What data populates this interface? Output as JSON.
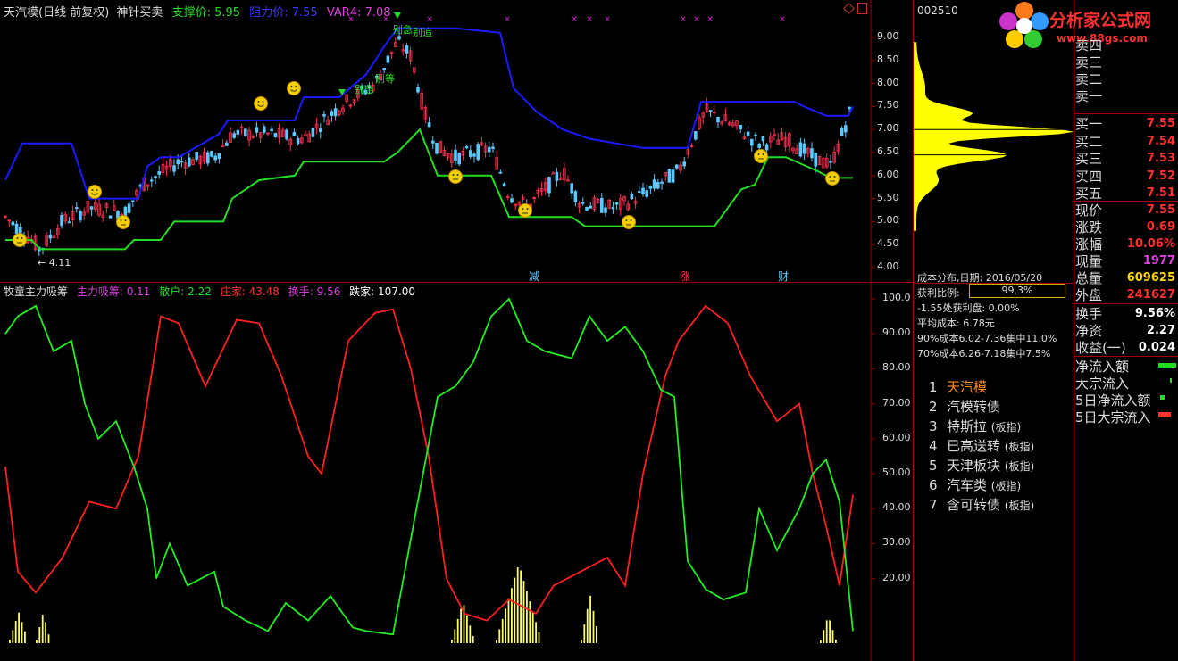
{
  "main_chart": {
    "stock_name": "天汽模(日线 前复权)",
    "indicator_name": "神针买卖",
    "support_label": "支撑价:",
    "support_value": "5.95",
    "resist_label": "阻力价:",
    "resist_value": "7.55",
    "var4_label": "VAR4:",
    "var4_value": "7.08",
    "low_marker": "← 4.11",
    "price_ticks": [
      "9.00",
      "8.50",
      "8.00",
      "7.50",
      "7.00",
      "6.50",
      "6.00",
      "5.50",
      "5.00",
      "4.50",
      "4.00"
    ],
    "event_labels": [
      "减",
      "涨",
      "财"
    ],
    "annotations": [
      "别急",
      "别追",
      "别等",
      "别急",
      "别追"
    ],
    "colors": {
      "resist_line": "#1a1aff",
      "support_line": "#22dd22",
      "up_candle": "#ff3050",
      "down_candle": "#5cc8ff",
      "marker": "#e020e0"
    }
  },
  "sub_chart": {
    "indicator_name": "牧童主力吸筹",
    "legend": [
      {
        "label": "主力吸筹:",
        "value": "0.11",
        "color": "#e040e0"
      },
      {
        "label": "散户:",
        "value": "2.22",
        "color": "#22dd22"
      },
      {
        "label": "庄家:",
        "value": "43.48",
        "color": "#ff3030"
      },
      {
        "label": "换手:",
        "value": "9.56",
        "color": "#e040e0"
      },
      {
        "label": "跌家:",
        "value": "107.00",
        "color": "#ffffff"
      }
    ],
    "y_ticks": [
      "100.0",
      "90.00",
      "80.00",
      "70.00",
      "60.00",
      "50.00",
      "40.00",
      "30.00",
      "20.00"
    ]
  },
  "middle_panel": {
    "code": "002510",
    "logo_text": "分析家公式网",
    "logo_url": "www.88gs.com",
    "cost_info": {
      "date_line": "成本分布,日期: 2016/05/20",
      "profit_label": "获利比例:",
      "profit_value": "99.3%",
      "lines": [
        "-1.55处获利盘: 0.00%",
        "平均成本: 6.78元",
        "90%成本6.02-7.36集中11.0%",
        "70%成本6.26-7.18集中7.5%"
      ]
    },
    "sectors": [
      {
        "num": "1",
        "name": "天汽模",
        "tag": ""
      },
      {
        "num": "2",
        "name": "汽模转债",
        "tag": ""
      },
      {
        "num": "3",
        "name": "特斯拉",
        "tag": "(板指)"
      },
      {
        "num": "4",
        "name": "已高送转",
        "tag": "(板指)"
      },
      {
        "num": "5",
        "name": "天津板块",
        "tag": "(板指)"
      },
      {
        "num": "6",
        "name": "汽车类",
        "tag": "(板指)"
      },
      {
        "num": "7",
        "name": "含可转债",
        "tag": "(板指)"
      }
    ]
  },
  "order_book": {
    "sell": [
      {
        "label": "卖四",
        "price": ""
      },
      {
        "label": "卖三",
        "price": ""
      },
      {
        "label": "卖二",
        "price": ""
      },
      {
        "label": "卖一",
        "price": ""
      }
    ],
    "buy": [
      {
        "label": "买一",
        "price": "7.55"
      },
      {
        "label": "买二",
        "price": "7.54"
      },
      {
        "label": "买三",
        "price": "7.53"
      },
      {
        "label": "买四",
        "price": "7.52"
      },
      {
        "label": "买五",
        "price": "7.51"
      }
    ],
    "stats": [
      {
        "label": "现价",
        "value": "7.55",
        "color": "#ff3030"
      },
      {
        "label": "涨跌",
        "value": "0.69",
        "color": "#ff3030"
      },
      {
        "label": "涨幅",
        "value": "10.06%",
        "color": "#ff3030"
      },
      {
        "label": "现量",
        "value": "1977",
        "color": "#e040e0"
      },
      {
        "label": "总量",
        "value": "609625",
        "color": "#ffd700"
      },
      {
        "label": "外盘",
        "value": "241627",
        "color": "#ff3030"
      }
    ],
    "stats2": [
      {
        "label": "换手",
        "value": "9.56%",
        "color": "#ffffff"
      },
      {
        "label": "净资",
        "value": "2.27",
        "color": "#ffffff"
      },
      {
        "label": "收益(一)",
        "value": "0.024",
        "color": "#ffffff"
      }
    ],
    "flows": [
      {
        "label": "净流入额",
        "color": "#22dd22"
      },
      {
        "label": "大宗流入",
        "color": "#22dd22"
      },
      {
        "label": "5日净流入额",
        "color": "#22dd22"
      },
      {
        "label": "5日大宗流入",
        "color": "#ff3030"
      }
    ]
  }
}
